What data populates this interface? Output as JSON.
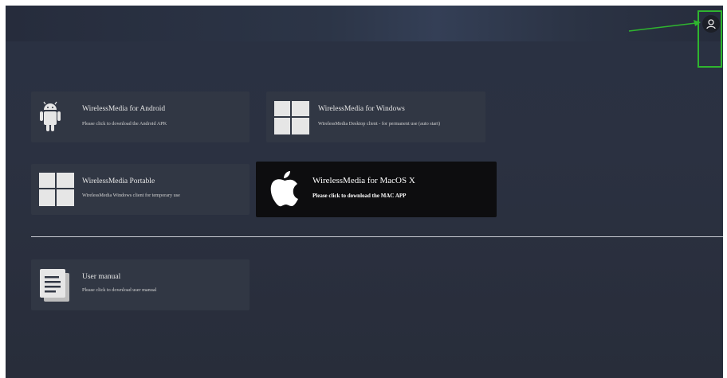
{
  "colors": {
    "highlight": "#2fb52f",
    "card_bg": "#313744",
    "card_dark_bg": "#0d0d0f",
    "background": "#2a3142"
  },
  "header": {
    "user_icon": "user-icon"
  },
  "cards": {
    "android": {
      "icon": "android-icon",
      "title": "WirelessMedia for Android",
      "subtitle": "Please click to download the Android APK"
    },
    "windows": {
      "icon": "windows-icon",
      "title": "WirelessMedia for Windows",
      "subtitle": "WirelessMedia Desktop client - for permanent use (auto start)"
    },
    "portable": {
      "icon": "windows-icon",
      "title": "WirelessMedia Portable",
      "subtitle": "WirelessMedia Windows client for temporary use"
    },
    "macos": {
      "icon": "apple-icon",
      "title": "WirelessMedia for MacOS X",
      "subtitle": "Please click to download the MAC APP"
    },
    "manual": {
      "icon": "document-icon",
      "title": "User manual",
      "subtitle": "Please click to download user manual"
    }
  }
}
